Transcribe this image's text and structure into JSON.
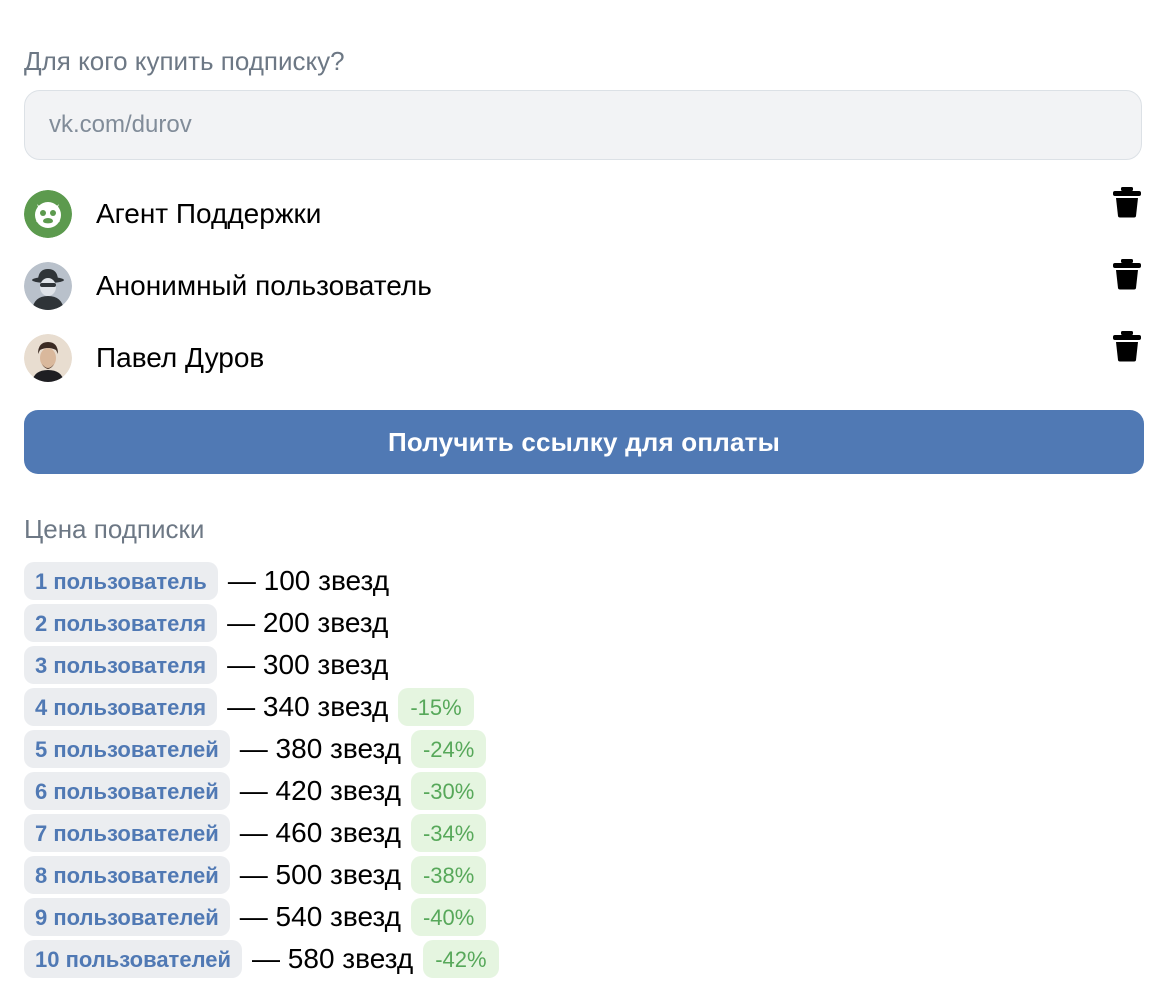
{
  "form": {
    "question": "Для кого купить подписку?",
    "input_placeholder": "vk.com/durov",
    "input_value": ""
  },
  "users": [
    {
      "name": "Агент Поддержки",
      "avatar_icon": "support-agent-avatar"
    },
    {
      "name": "Анонимный пользователь",
      "avatar_icon": "anonymous-avatar"
    },
    {
      "name": "Павел Дуров",
      "avatar_icon": "photo-avatar"
    }
  ],
  "pay_button": {
    "label": "Получить ссылку для оплаты"
  },
  "pricing": {
    "title": "Цена подписки",
    "rows": [
      {
        "users": "1 пользователь",
        "price": "— 100 звезд",
        "discount": ""
      },
      {
        "users": "2 пользователя",
        "price": "— 200 звезд",
        "discount": ""
      },
      {
        "users": "3 пользователя",
        "price": "— 300 звезд",
        "discount": ""
      },
      {
        "users": "4 пользователя",
        "price": "— 340 звезд",
        "discount": "-15%"
      },
      {
        "users": "5 пользователей",
        "price": "— 380 звезд",
        "discount": "-24%"
      },
      {
        "users": "6 пользователей",
        "price": "— 420 звезд",
        "discount": "-30%"
      },
      {
        "users": "7 пользователей",
        "price": "— 460 звезд",
        "discount": "-34%"
      },
      {
        "users": "8 пользователей",
        "price": "— 500 звезд",
        "discount": "-38%"
      },
      {
        "users": "9 пользователей",
        "price": "— 540 звезд",
        "discount": "-40%"
      },
      {
        "users": "10 пользователей",
        "price": "— 580 звезд",
        "discount": "-42%"
      }
    ]
  },
  "colors": {
    "accent": "#5079b4",
    "secondary_text": "#6d7885",
    "chip_bg": "#ebedf0",
    "discount_bg": "#e5f5e0",
    "discount_text": "#57a85a"
  }
}
